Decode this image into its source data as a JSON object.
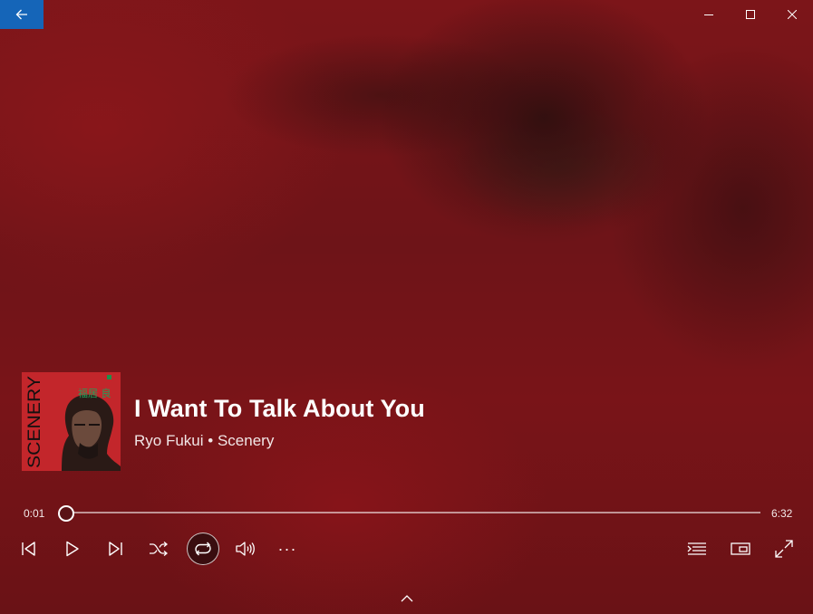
{
  "window": {
    "back_icon": "arrow-left-icon",
    "minimize_icon": "minimize-icon",
    "maximize_icon": "maximize-icon",
    "close_icon": "close-icon",
    "accent": "#1565b8"
  },
  "now_playing": {
    "title": "I Want To Talk About You",
    "artist": "Ryo Fukui",
    "separator": "•",
    "album": "Scenery",
    "album_art": {
      "cover_text": "SCENERY",
      "artist_jp": "福居 良",
      "background": "#c3262b"
    }
  },
  "playback": {
    "current_time": "0:01",
    "total_time": "6:32",
    "progress_fraction": 0.003
  },
  "controls": {
    "previous": "skip-previous-icon",
    "play": "play-icon",
    "next": "skip-next-icon",
    "shuffle": "shuffle-icon",
    "repeat": "repeat-icon",
    "volume": "volume-icon",
    "more": "···",
    "now_playing_list": "playlist-icon",
    "mini_player": "mini-player-icon",
    "full_screen": "full-screen-icon",
    "expand": "chevron-up-icon"
  }
}
